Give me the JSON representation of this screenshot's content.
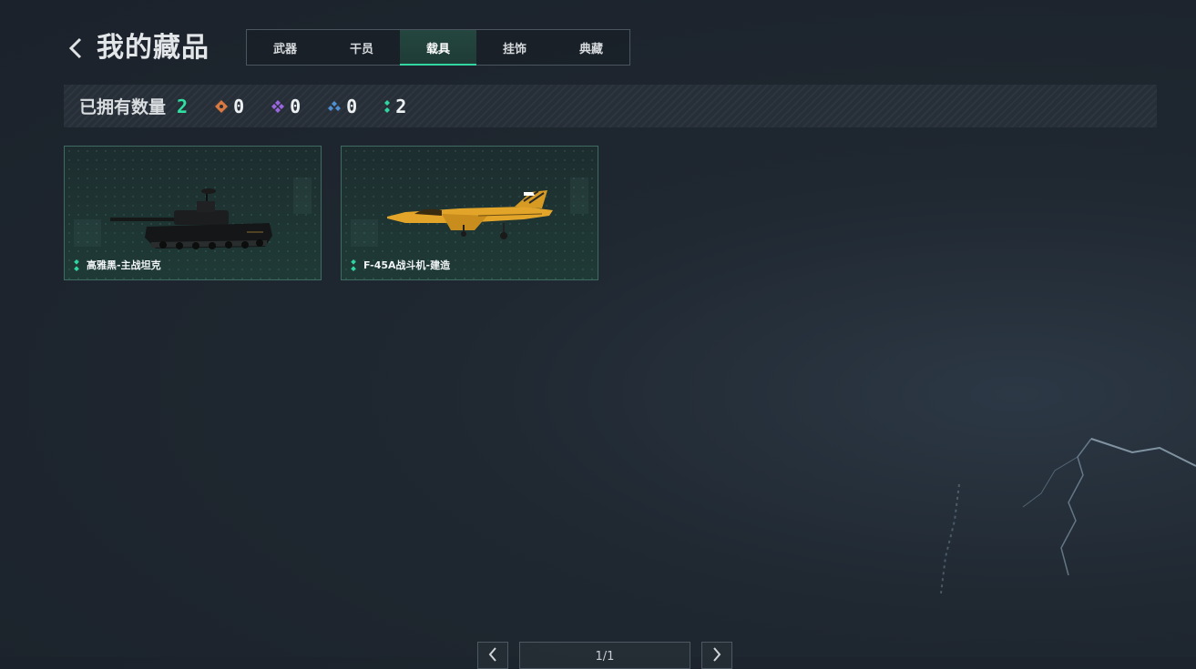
{
  "header": {
    "title": "我的藏品",
    "tabs": [
      {
        "label": "武器",
        "active": false
      },
      {
        "label": "干员",
        "active": false
      },
      {
        "label": "载具",
        "active": true
      },
      {
        "label": "挂饰",
        "active": false
      },
      {
        "label": "典藏",
        "active": false
      }
    ]
  },
  "stats": {
    "label": "已拥有数量",
    "total": "2",
    "rarities": [
      {
        "icon": "orange-diamond-icon",
        "color": "#d9793f",
        "count": "0"
      },
      {
        "icon": "purple-diamond-icon",
        "color": "#9a67e0",
        "count": "0"
      },
      {
        "icon": "blue-diamond-icon",
        "color": "#4f8fd6",
        "count": "0"
      },
      {
        "icon": "green-dots-icon",
        "color": "#2fd6a0",
        "count": "2"
      }
    ]
  },
  "items": [
    {
      "name": "高雅黑-主战坦克",
      "icon": "green-dots-icon",
      "image": "tank-image"
    },
    {
      "name": "F-45A战斗机-建造",
      "icon": "green-dots-icon",
      "image": "fighter-jet-image"
    }
  ],
  "pagination": {
    "page_label": "1/1"
  },
  "colors": {
    "accent": "#2fe0a0",
    "card_border": "#3f6b62"
  }
}
